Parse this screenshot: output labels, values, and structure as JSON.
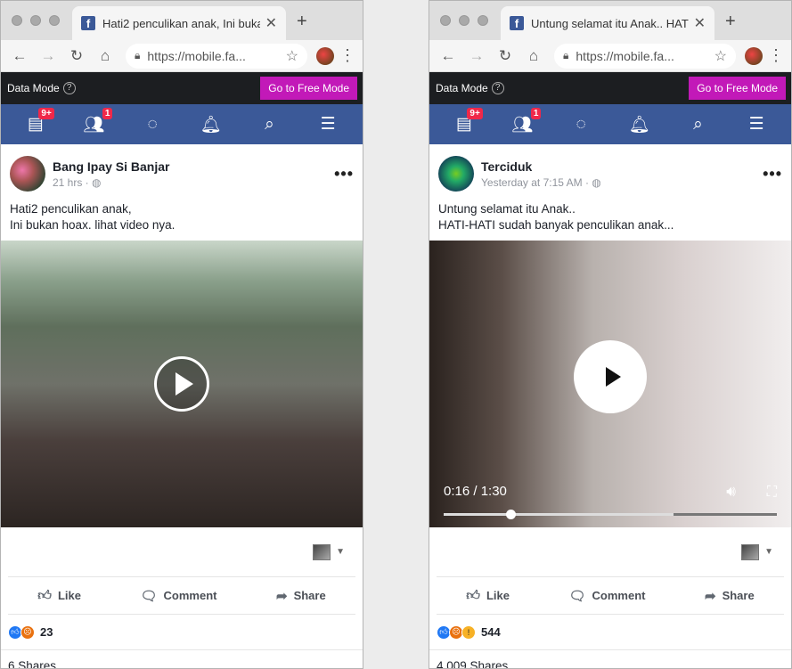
{
  "windows": [
    {
      "tab_title": "Hati2 penculikan anak, Ini buka",
      "url": "https://mobile.fa...",
      "data_mode": "Data Mode",
      "free_mode_button": "Go to Free Mode",
      "badges": {
        "feed": "9+",
        "friends": "1"
      },
      "post": {
        "author": "Bang Ipay Si Banjar",
        "time": "21 hrs · ",
        "text_line1": "Hati2 penculikan anak,",
        "text_line2": "Ini bukan hoax. lihat video nya.",
        "reaction_count": "23",
        "shares": "6 Shares"
      },
      "actions": {
        "like": "Like",
        "comment": "Comment",
        "share": "Share"
      }
    },
    {
      "tab_title": "Untung selamat itu Anak.. HAT",
      "url": "https://mobile.fa...",
      "data_mode": "Data Mode",
      "free_mode_button": "Go to Free Mode",
      "badges": {
        "feed": "9+",
        "friends": "1"
      },
      "post": {
        "author": "Terciduk",
        "time": "Yesterday at 7:15 AM · ",
        "text_line1": "Untung selamat itu Anak..",
        "text_line2": "HATI-HATI sudah banyak penculikan anak...",
        "video_time": "0:16 / 1:30",
        "video_progress": 0.2,
        "video_buffered": 0.69,
        "reaction_count": "544",
        "shares": "4,009 Shares"
      },
      "actions": {
        "like": "Like",
        "comment": "Comment",
        "share": "Share"
      }
    }
  ]
}
